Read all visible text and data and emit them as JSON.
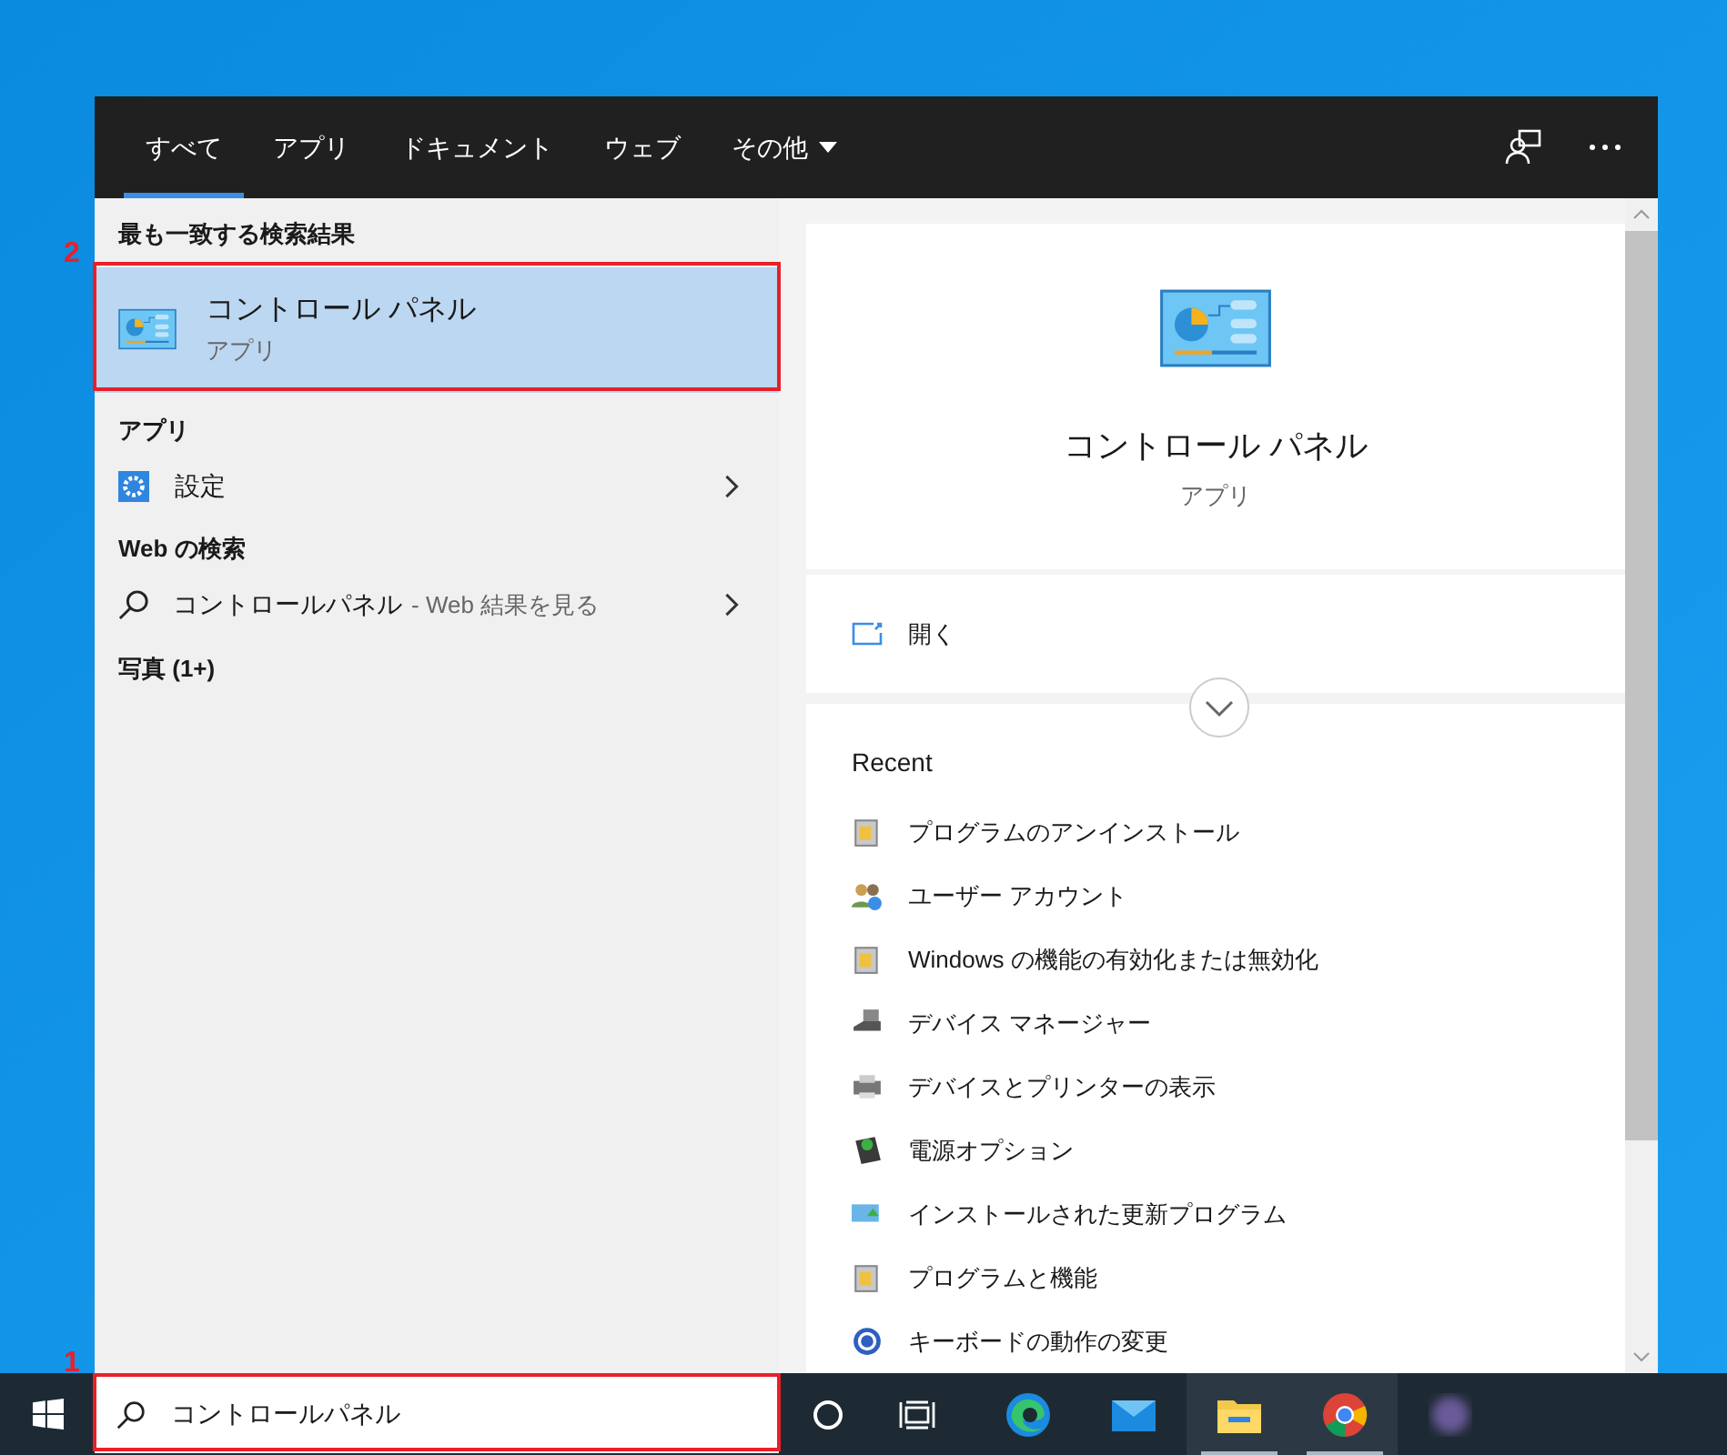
{
  "tabs": [
    {
      "label": "すべて",
      "selected": true,
      "has_menu": false
    },
    {
      "label": "アプリ",
      "selected": false,
      "has_menu": false
    },
    {
      "label": "ドキュメント",
      "selected": false,
      "has_menu": false
    },
    {
      "label": "ウェブ",
      "selected": false,
      "has_menu": false
    },
    {
      "label": "その他",
      "selected": false,
      "has_menu": true
    }
  ],
  "best_match": {
    "heading": "最も一致する検索結果",
    "title": "コントロール パネル",
    "subtitle": "アプリ",
    "selected": true
  },
  "apps": {
    "heading": "アプリ",
    "items": [
      {
        "label": "設定"
      }
    ]
  },
  "web": {
    "heading": "Web の検索",
    "items": [
      {
        "query": "コントロールパネル",
        "suffix": "- Web 結果を見る"
      }
    ]
  },
  "photos": {
    "heading": "写真 (1+)"
  },
  "preview": {
    "title": "コントロール パネル",
    "subtitle": "アプリ",
    "actions": [
      {
        "label": "開く"
      }
    ],
    "recent_heading": "Recent",
    "recent": [
      {
        "label": "プログラムのアンインストール",
        "kind": "program"
      },
      {
        "label": "ユーザー アカウント",
        "kind": "users"
      },
      {
        "label": "Windows の機能の有効化または無効化",
        "kind": "program"
      },
      {
        "label": "デバイス マネージャー",
        "kind": "device"
      },
      {
        "label": "デバイスとプリンターの表示",
        "kind": "printer"
      },
      {
        "label": "電源オプション",
        "kind": "power"
      },
      {
        "label": "インストールされた更新プログラム",
        "kind": "update"
      },
      {
        "label": "プログラムと機能",
        "kind": "program"
      },
      {
        "label": "キーボードの動作の変更",
        "kind": "keyboard"
      }
    ]
  },
  "taskbar": {
    "search_value": "コントロールパネル",
    "apps": [
      {
        "kind": "edge",
        "running": false
      },
      {
        "kind": "mail",
        "running": false
      },
      {
        "kind": "explorer",
        "running": true
      },
      {
        "kind": "chrome",
        "running": true
      },
      {
        "kind": "blurred",
        "running": false
      }
    ]
  },
  "annotations": [
    {
      "label": "2"
    },
    {
      "label": "1"
    }
  ]
}
